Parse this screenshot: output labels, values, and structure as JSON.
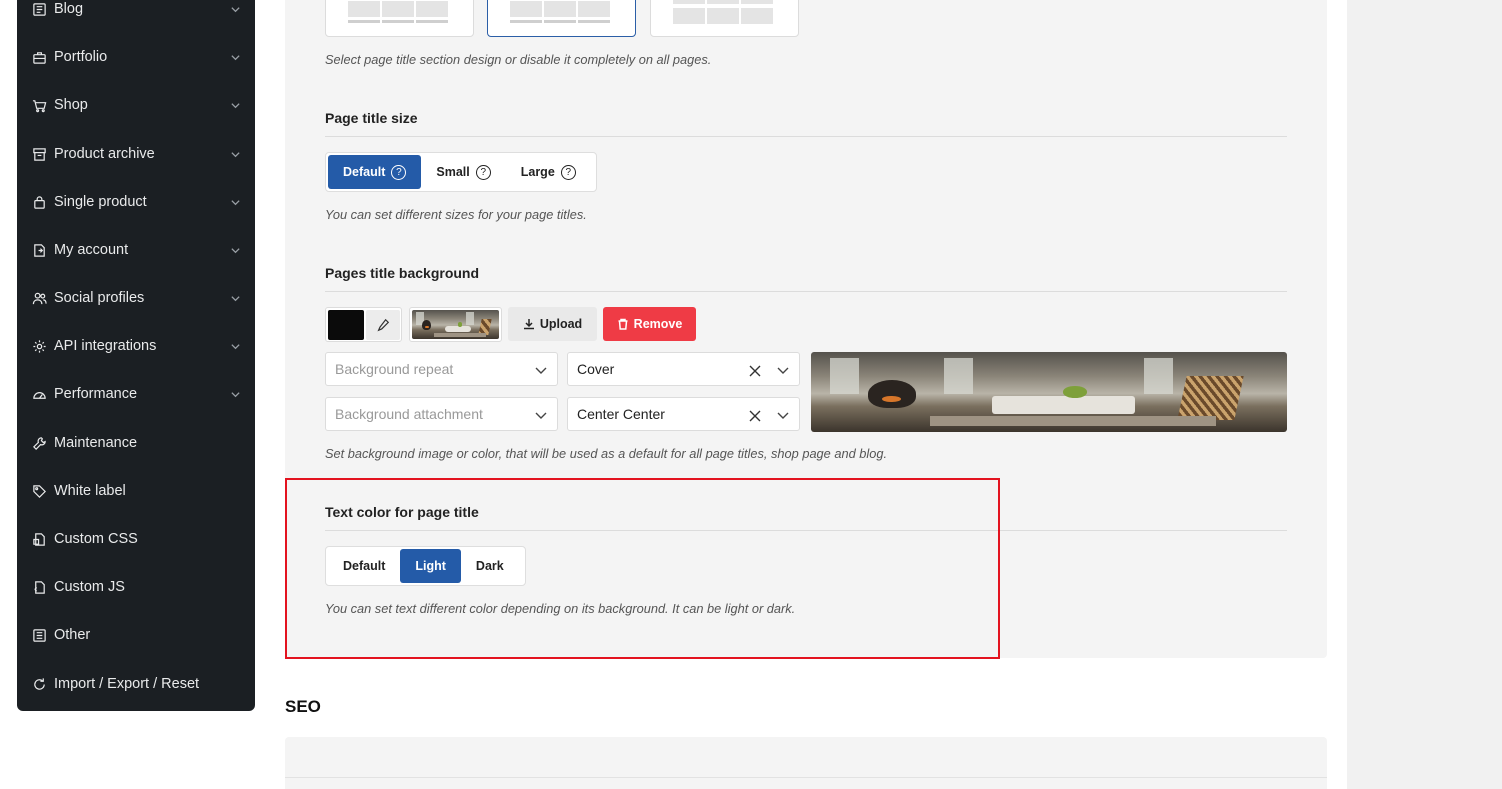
{
  "sidebar": {
    "items": [
      {
        "label": "Blog",
        "icon": "blog-icon",
        "has_children": true
      },
      {
        "label": "Portfolio",
        "icon": "briefcase-icon",
        "has_children": true
      },
      {
        "label": "Shop",
        "icon": "cart-icon",
        "has_children": true
      },
      {
        "label": "Product archive",
        "icon": "archive-icon",
        "has_children": true
      },
      {
        "label": "Single product",
        "icon": "bag-icon",
        "has_children": true
      },
      {
        "label": "My account",
        "icon": "account-icon",
        "has_children": true
      },
      {
        "label": "Social profiles",
        "icon": "people-icon",
        "has_children": true
      },
      {
        "label": "API integrations",
        "icon": "gear-icon",
        "has_children": true
      },
      {
        "label": "Performance",
        "icon": "gauge-icon",
        "has_children": true
      },
      {
        "label": "Maintenance",
        "icon": "wrench-icon",
        "has_children": false
      },
      {
        "label": "White label",
        "icon": "tag-icon",
        "has_children": false
      },
      {
        "label": "Custom CSS",
        "icon": "css-file-icon",
        "has_children": false
      },
      {
        "label": "Custom JS",
        "icon": "js-file-icon",
        "has_children": false
      },
      {
        "label": "Other",
        "icon": "list-icon",
        "has_children": false
      },
      {
        "label": "Import / Export / Reset",
        "icon": "reset-icon",
        "has_children": false
      }
    ]
  },
  "page_title_design": {
    "hint": "Select page title section design or disable it completely on all pages.",
    "selected_index": 1
  },
  "page_title_size": {
    "title": "Page title size",
    "options": [
      "Default",
      "Small",
      "Large"
    ],
    "selected": "Default",
    "help_icon": "question-circle-icon",
    "hint": "You can set different sizes for your page titles."
  },
  "pages_title_background": {
    "title": "Pages title background",
    "color": "#0b0b0b",
    "upload_label": "Upload",
    "remove_label": "Remove",
    "background_repeat_placeholder": "Background repeat",
    "background_size_value": "Cover",
    "background_attachment_placeholder": "Background attachment",
    "background_position_value": "Center Center",
    "hint": "Set background image or color, that will be used as a default for all page titles, shop page and blog."
  },
  "text_color": {
    "title": "Text color for page title",
    "options": [
      "Default",
      "Light",
      "Dark"
    ],
    "selected": "Light",
    "hint": "You can set text different color depending on its background. It can be light or dark."
  },
  "seo": {
    "title": "SEO"
  },
  "colors": {
    "accent": "#245ba8",
    "danger": "#ef3b45",
    "sidebar_bg": "#1b1f23",
    "highlight": "#e3131f"
  }
}
